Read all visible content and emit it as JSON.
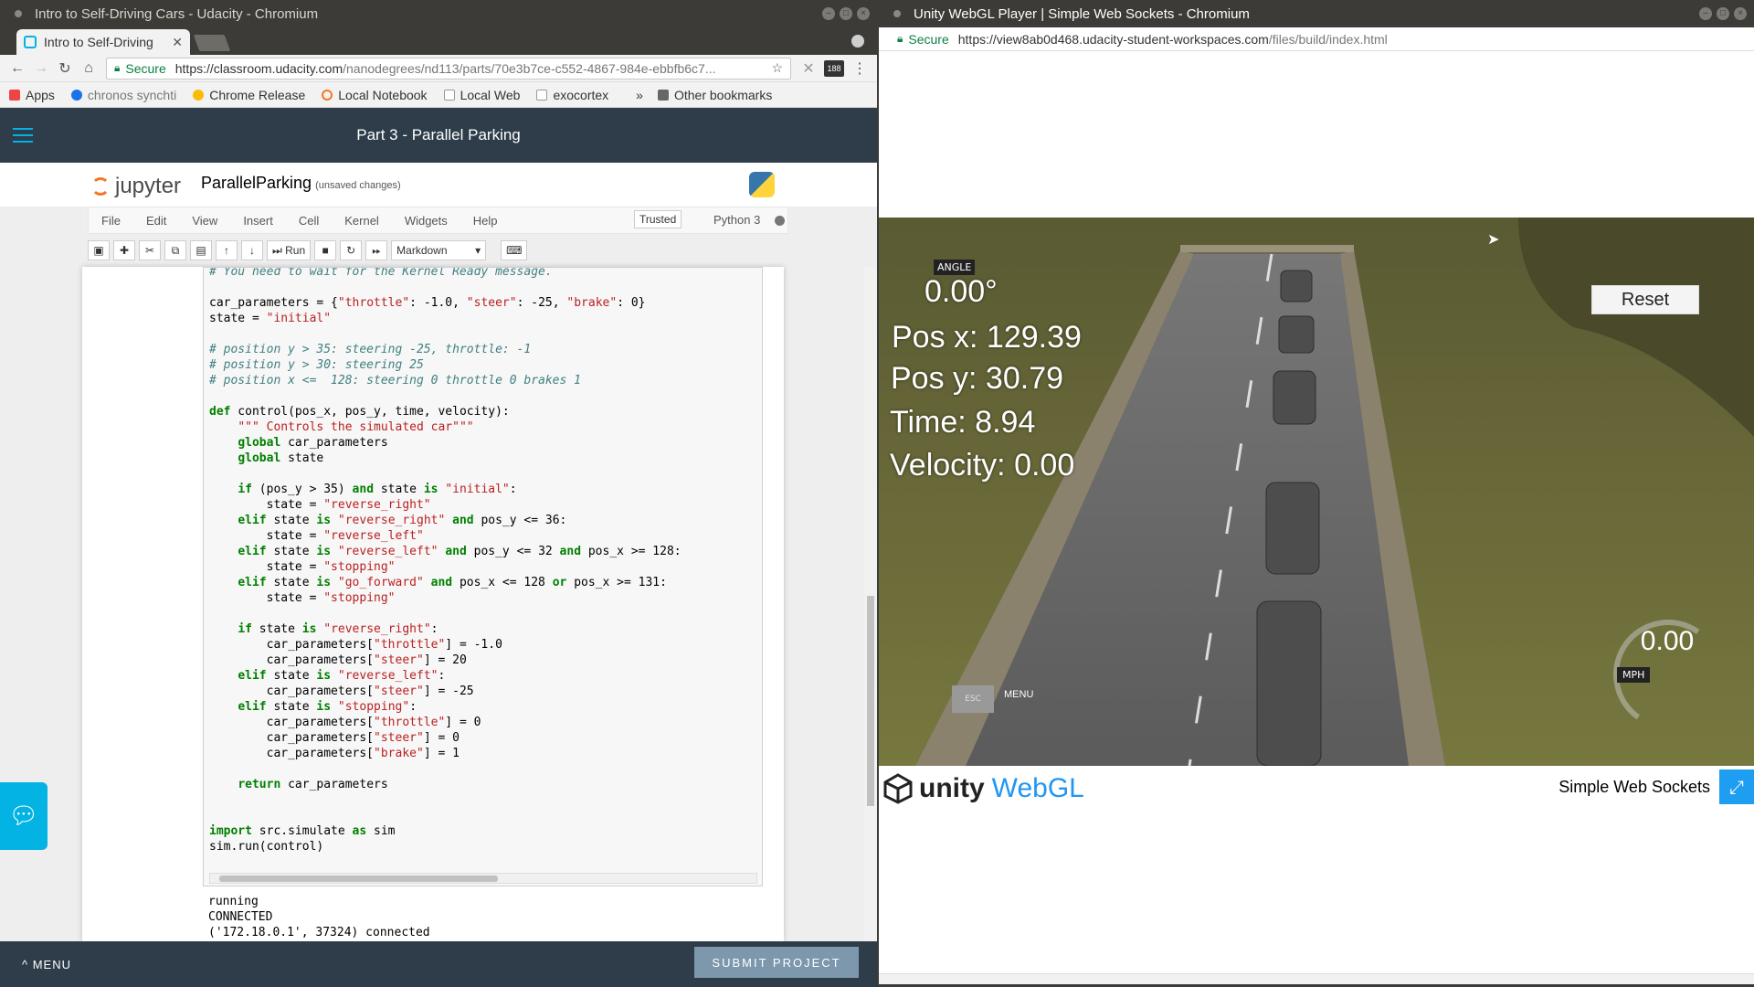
{
  "left_window": {
    "title": "Intro to Self-Driving Cars - Udacity - Chromium",
    "tab_label": "Intro to Self-Driving",
    "omnibox": {
      "secure": "Secure",
      "host": "https://classroom.udacity.com",
      "path": "/nanodegrees/nd113/parts/70e3b7ce-c552-4867-984e-ebbfb6c7..."
    },
    "extension_badge": "188",
    "bookmarks": [
      {
        "label": "Apps",
        "color": "#e44"
      },
      {
        "label": "chronos synchti",
        "color": "#1a73e8"
      },
      {
        "label": "Chrome Release",
        "color": "#fbbc05"
      },
      {
        "label": "Local Notebook",
        "color": "#f37726"
      },
      {
        "label": "Local Web",
        "color": "#999"
      },
      {
        "label": "exocortex",
        "color": "#999"
      }
    ],
    "bookmarks_overflow": "»",
    "other_bookmarks": "Other bookmarks",
    "udacity": {
      "header_title": "Part 3 - Parallel Parking",
      "menu_label": "MENU",
      "submit_label": "SUBMIT PROJECT"
    },
    "jupyter": {
      "logo_text": "jupyter",
      "notebook_name": "ParallelParking",
      "unsaved": "(unsaved changes)",
      "menu": [
        "File",
        "Edit",
        "View",
        "Insert",
        "Cell",
        "Kernel",
        "Widgets",
        "Help"
      ],
      "trusted": "Trusted",
      "kernel": "Python 3",
      "run_label": "Run",
      "cell_type": "Markdown",
      "code_lines": [
        "# You need to wait for the Kernel Ready message.",
        "",
        "car_parameters = {\"throttle\": -1.0, \"steer\": -25, \"brake\": 0}",
        "state = \"initial\"",
        "",
        "# position y > 35: steering -25, throttle: -1",
        "# position y > 30: steering 25",
        "# position x <=  128: steering 0 throttle 0 brakes 1",
        "",
        "def control(pos_x, pos_y, time, velocity):",
        "    \"\"\" Controls the simulated car\"\"\"",
        "    global car_parameters",
        "    global state",
        "",
        "    if (pos_y > 35) and state is \"initial\":",
        "        state = \"reverse_right\"",
        "    elif state is \"reverse_right\" and pos_y <= 36:",
        "        state = \"reverse_left\"",
        "    elif state is \"reverse_left\" and pos_y <= 32 and pos_x >= 128:",
        "        state = \"stopping\"",
        "    elif state is \"go_forward\" and pos_x <= 128 or pos_x >= 131:",
        "        state = \"stopping\"",
        "",
        "    if state is \"reverse_right\":",
        "        car_parameters[\"throttle\"] = -1.0",
        "        car_parameters[\"steer\"] = 20",
        "    elif state is \"reverse_left\":",
        "        car_parameters[\"steer\"] = -25",
        "    elif state is \"stopping\":",
        "        car_parameters[\"throttle\"] = 0",
        "        car_parameters[\"steer\"] = 0",
        "        car_parameters[\"brake\"] = 1",
        "",
        "    return car_parameters",
        "",
        "",
        "import src.simulate as sim",
        "sim.run(control)"
      ],
      "output_lines": [
        "running",
        "CONNECTED",
        "('172.18.0.1', 37324) connected"
      ]
    }
  },
  "right_window": {
    "title": "Unity WebGL Player | Simple Web Sockets - Chromium",
    "omnibox": {
      "secure": "Secure",
      "url_host": "https://view8ab0d468.udacity-student-workspaces.com",
      "url_path": "/files/build/index.html"
    },
    "game": {
      "angle_label": "ANGLE",
      "angle_value": "0.00°",
      "pos_x": "Pos x: 129.39",
      "pos_y": "Pos y: 30.79",
      "time": "Time: 8.94",
      "velocity": "Velocity: 0.00",
      "reset_label": "Reset",
      "esc_label": "ESC",
      "menu_label": "MENU",
      "speed_value": "0.00",
      "speed_unit": "MPH"
    },
    "footer": {
      "unity": "unity",
      "webgl": "WebGL",
      "page_title": "Simple Web Sockets"
    }
  }
}
